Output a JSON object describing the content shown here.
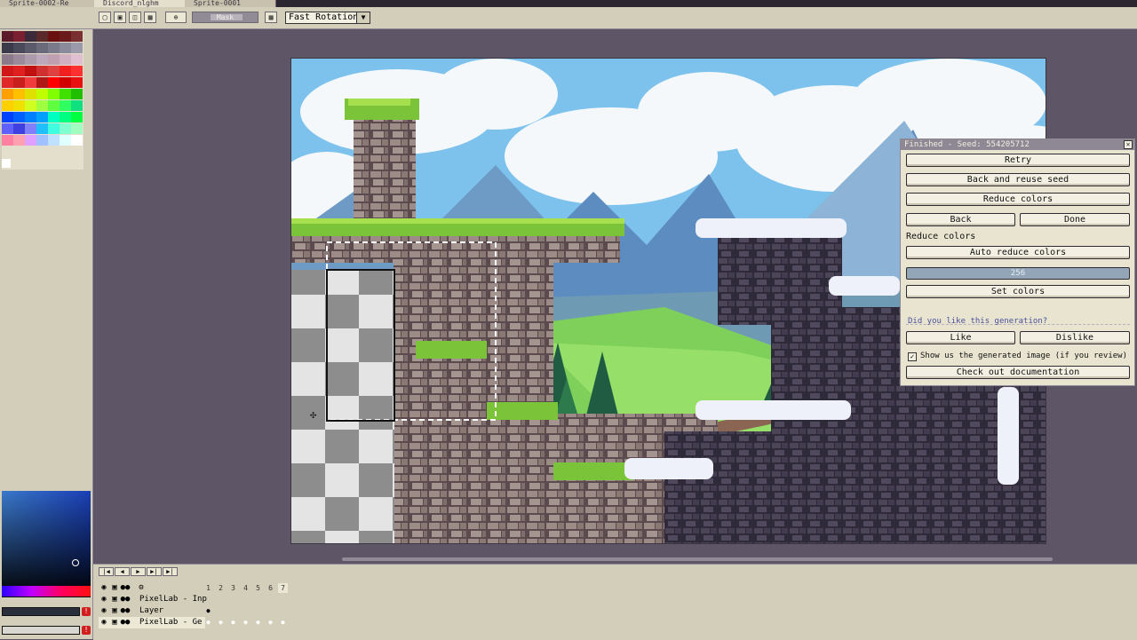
{
  "tabs": [
    "Sprite-0002-Re",
    "Discord_nlghm",
    "Sprite-0001"
  ],
  "toolbar": {
    "slider_label": "Mask",
    "rotation_value": "Fast Rotation"
  },
  "timeline": {
    "frames": [
      "1",
      "2",
      "3",
      "4",
      "5",
      "6",
      "7"
    ],
    "layers": [
      "PixelLab - Inp",
      "Layer",
      "PixelLab - Ge"
    ]
  },
  "pixellab": {
    "title": "Finished - Seed: 554205712",
    "retry": "Retry",
    "back_reuse": "Back and reuse seed",
    "reduce_colors_btn": "Reduce colors",
    "back": "Back",
    "done": "Done",
    "reduce_colors_label": "Reduce colors",
    "auto_reduce": "Auto reduce colors",
    "color_count": "256",
    "set_colors": "Set colors",
    "did_you_like": "Did you like this generation?",
    "like": "Like",
    "dislike": "Dislike",
    "show_us": "Show us the generated image (if you review)",
    "docs": "Check out documentation"
  },
  "colors": {
    "accent_bar": "#93a6b8",
    "panel_bg": "#e8e4d0",
    "workspace": "#5e5666"
  }
}
